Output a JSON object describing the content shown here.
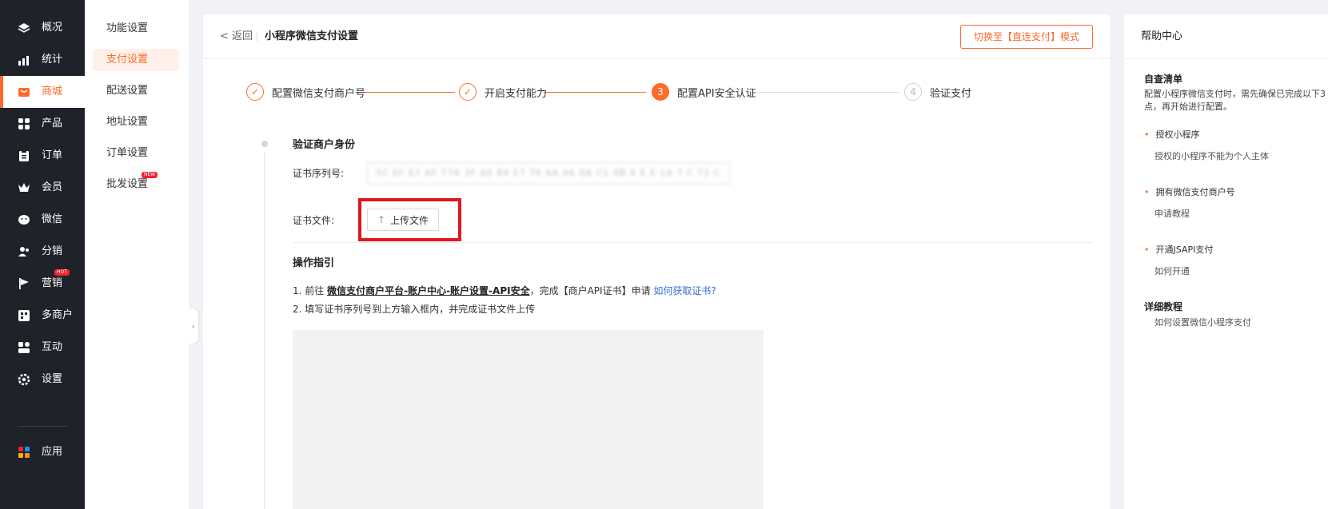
{
  "nav": {
    "items": [
      {
        "label": "概况",
        "icon": "layers-icon"
      },
      {
        "label": "统计",
        "icon": "chart-icon"
      },
      {
        "label": "商城",
        "icon": "shop-icon"
      },
      {
        "label": "产品",
        "icon": "grid-icon"
      },
      {
        "label": "订单",
        "icon": "clipboard-icon"
      },
      {
        "label": "会员",
        "icon": "crown-icon"
      },
      {
        "label": "微信",
        "icon": "wechat-icon"
      },
      {
        "label": "分销",
        "icon": "users-icon"
      },
      {
        "label": "营销",
        "icon": "flag-icon",
        "badge": "HOT"
      },
      {
        "label": "多商户",
        "icon": "stores-icon"
      },
      {
        "label": "互动",
        "icon": "interact-icon"
      },
      {
        "label": "设置",
        "icon": "gear-icon"
      },
      {
        "label": "应用",
        "icon": "apps-icon"
      }
    ]
  },
  "subnav": {
    "items": [
      {
        "label": "功能设置"
      },
      {
        "label": "支付设置"
      },
      {
        "label": "配送设置"
      },
      {
        "label": "地址设置"
      },
      {
        "label": "订单设置"
      },
      {
        "label": "批发设置",
        "badge": "NEW"
      }
    ]
  },
  "header": {
    "back": "< 返回",
    "title": "小程序微信支付设置",
    "switch_button": "切换至【直连支付】模式"
  },
  "steps": [
    {
      "label": "配置微信支付商户号",
      "mark": "✓"
    },
    {
      "label": "开启支付能力",
      "mark": "✓"
    },
    {
      "label": "配置API安全认证",
      "mark": "3"
    },
    {
      "label": "验证支付",
      "mark": "4"
    }
  ],
  "verify": {
    "title": "验证商户身份",
    "serial_label": "证书序列号:",
    "serial_value": "5C EF E7 AF T7A 3F A0 84 E7 T6 6A A6 0A C1 0B A E E 1A 7 C T2 C",
    "file_label": "证书文件:",
    "upload_label": "上传文件"
  },
  "guide": {
    "title": "操作指引",
    "line1_prefix": "1. 前往",
    "line1_strong": "微信支付商户平台-账户中心-账户设置-API安全",
    "line1_middle": "，完成【商户API证书】申请",
    "line1_link": "如何获取证书?",
    "line2": "2. 填写证书序列号到上方输入框内，并完成证书文件上传"
  },
  "help": {
    "title": "帮助中心",
    "checklist_title": "自查清单",
    "checklist_desc": "配置小程序微信支付时，需先确保已完成以下3点，再开始进行配置。",
    "items": [
      {
        "label": "授权小程序",
        "desc": "授权的小程序不能为个人主体"
      },
      {
        "label": "拥有微信支付商户号",
        "desc": "申请教程"
      },
      {
        "label": "开通JSAPI支付",
        "desc": "如何开通"
      }
    ],
    "tutorial_title": "详细教程",
    "tutorial_link": "如何设置微信小程序支付"
  },
  "colors": {
    "accent": "#ff6a2b",
    "sidebar": "#1f2229",
    "highlight": "#e0171f",
    "link": "#3a6ed6"
  }
}
